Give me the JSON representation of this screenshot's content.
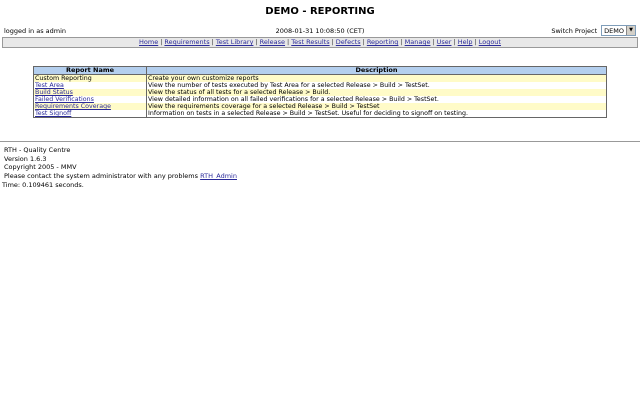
{
  "header": {
    "title": "DEMO - REPORTING",
    "login": "logged in as admin",
    "datetime": "2008-01-31 10:08:50 (CET)",
    "switch_label": "Switch Project",
    "project": "DEMO"
  },
  "nav": [
    "Home",
    "Requirements",
    "Test Library",
    "Release",
    "Test Results",
    "Defects",
    "Reporting",
    "Manage",
    "User",
    "Help",
    "Logout"
  ],
  "table": {
    "headers": [
      "Report Name",
      "Description"
    ],
    "rows": [
      {
        "name": "Custom Reporting",
        "link": false,
        "desc": "Create your own customize reports"
      },
      {
        "name": "Test Area",
        "link": true,
        "desc": "View the number of tests executed by Test Area for a selected Release > Build > TestSet."
      },
      {
        "name": "Build Status",
        "link": true,
        "desc": "View the status of all tests for a selected Release > Build."
      },
      {
        "name": "Failed Verifications",
        "link": true,
        "desc": "View detailed information on all failed verifications for a selected Release > Build > TestSet."
      },
      {
        "name": "Requirements Coverage",
        "link": true,
        "desc": "View the requirements coverage for a selected Release > Build > TestSet"
      },
      {
        "name": "Test Signoff",
        "link": true,
        "desc": "Information on tests in a selected Release > Build > TestSet. Useful for deciding to signoff on testing."
      }
    ]
  },
  "footer": {
    "product": "RTH - Quality Centre",
    "version": "Version 1.6.3",
    "copyright": "Copyright 2005 - MMV",
    "contact": "Please contact the system administrator with any problems",
    "admin_link": "RTH_Admin",
    "time": "Time: 0.109461 seconds."
  }
}
